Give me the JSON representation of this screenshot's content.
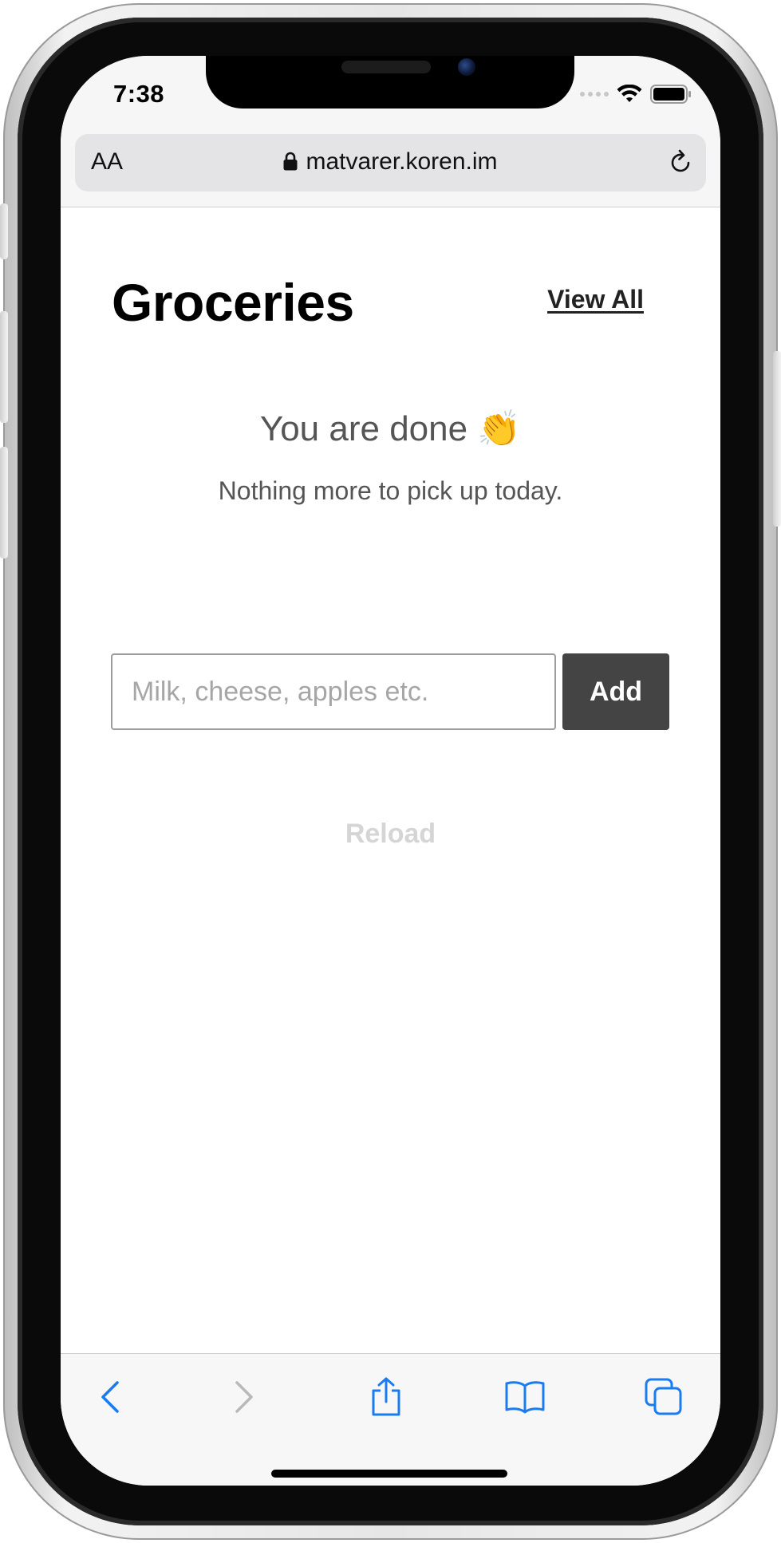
{
  "status_bar": {
    "time": "7:38"
  },
  "browser": {
    "text_size_label": "AA",
    "url": "matvarer.koren.im"
  },
  "page": {
    "title": "Groceries",
    "view_all_label": "View All",
    "done_title": "You are done 👏",
    "done_subtitle": "Nothing more to pick up today.",
    "item_input_placeholder": "Milk, cheese, apples etc.",
    "item_input_value": "",
    "add_button_label": "Add",
    "reload_label": "Reload"
  },
  "toolbar": {
    "items": [
      "back-icon",
      "forward-icon",
      "share-icon",
      "bookmarks-icon",
      "tabs-icon"
    ]
  },
  "colors": {
    "accent": "#1a7cf0",
    "add_button_bg": "#444444",
    "reload_disabled": "#d5d5d5",
    "text_muted": "#555555"
  }
}
